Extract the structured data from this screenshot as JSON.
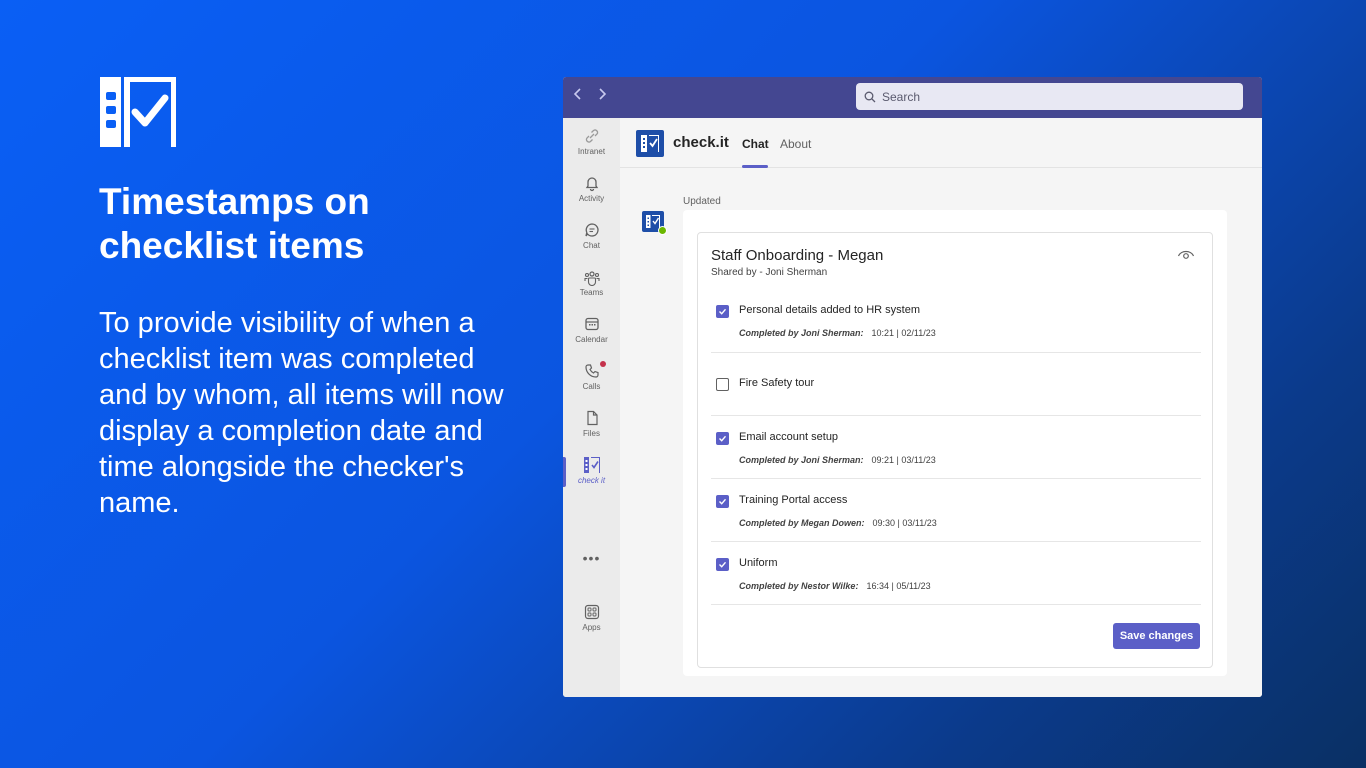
{
  "promo": {
    "title": "Timestamps on checklist items",
    "text": "To provide visibility of when a checklist item was completed and by whom, all items will now display a completion date and time alongside the checker's name."
  },
  "window": {
    "search_placeholder": "Search",
    "nav_back_icon": "chevron-left-icon",
    "nav_forward_icon": "chevron-right-icon"
  },
  "rail": {
    "items": [
      {
        "label": "Intranet",
        "icon": "link-icon"
      },
      {
        "label": "Activity",
        "icon": "bell-icon"
      },
      {
        "label": "Chat",
        "icon": "chat-icon"
      },
      {
        "label": "Teams",
        "icon": "teams-icon"
      },
      {
        "label": "Calendar",
        "icon": "calendar-icon"
      },
      {
        "label": "Calls",
        "icon": "phone-icon"
      },
      {
        "label": "Files",
        "icon": "file-icon"
      },
      {
        "label": "check it",
        "icon": "checkit-icon"
      },
      {
        "label": "Apps",
        "icon": "apps-icon"
      }
    ],
    "more": "•••"
  },
  "app": {
    "name": "check.it",
    "tabs": {
      "chat": "Chat",
      "about": "About"
    }
  },
  "message": {
    "status": "Updated",
    "checklist": {
      "title": "Staff Onboarding - Megan",
      "shared_by": "Shared by - Joni Sherman",
      "items": [
        {
          "label": "Personal details added to HR system",
          "checked": true,
          "by": "Completed by Joni Sherman:",
          "time": "10:21 | 02/11/23"
        },
        {
          "label": "Fire Safety tour",
          "checked": false
        },
        {
          "label": "Email account setup",
          "checked": true,
          "by": "Completed by Joni Sherman:",
          "time": "09:21 | 03/11/23"
        },
        {
          "label": "Training Portal access",
          "checked": true,
          "by": "Completed by Megan Dowen:",
          "time": "09:30 | 03/11/23"
        },
        {
          "label": "Uniform",
          "checked": true,
          "by": "Completed by Nestor Wilke:",
          "time": "16:34 | 05/11/23"
        }
      ],
      "save_label": "Save changes"
    }
  },
  "colors": {
    "background": "#0a5ff5",
    "titlebar": "#444791",
    "accent": "#5b5fc7",
    "app_icon": "#1e4ea8",
    "presence": "#6bb700",
    "notification_dot": "#c4314b"
  }
}
